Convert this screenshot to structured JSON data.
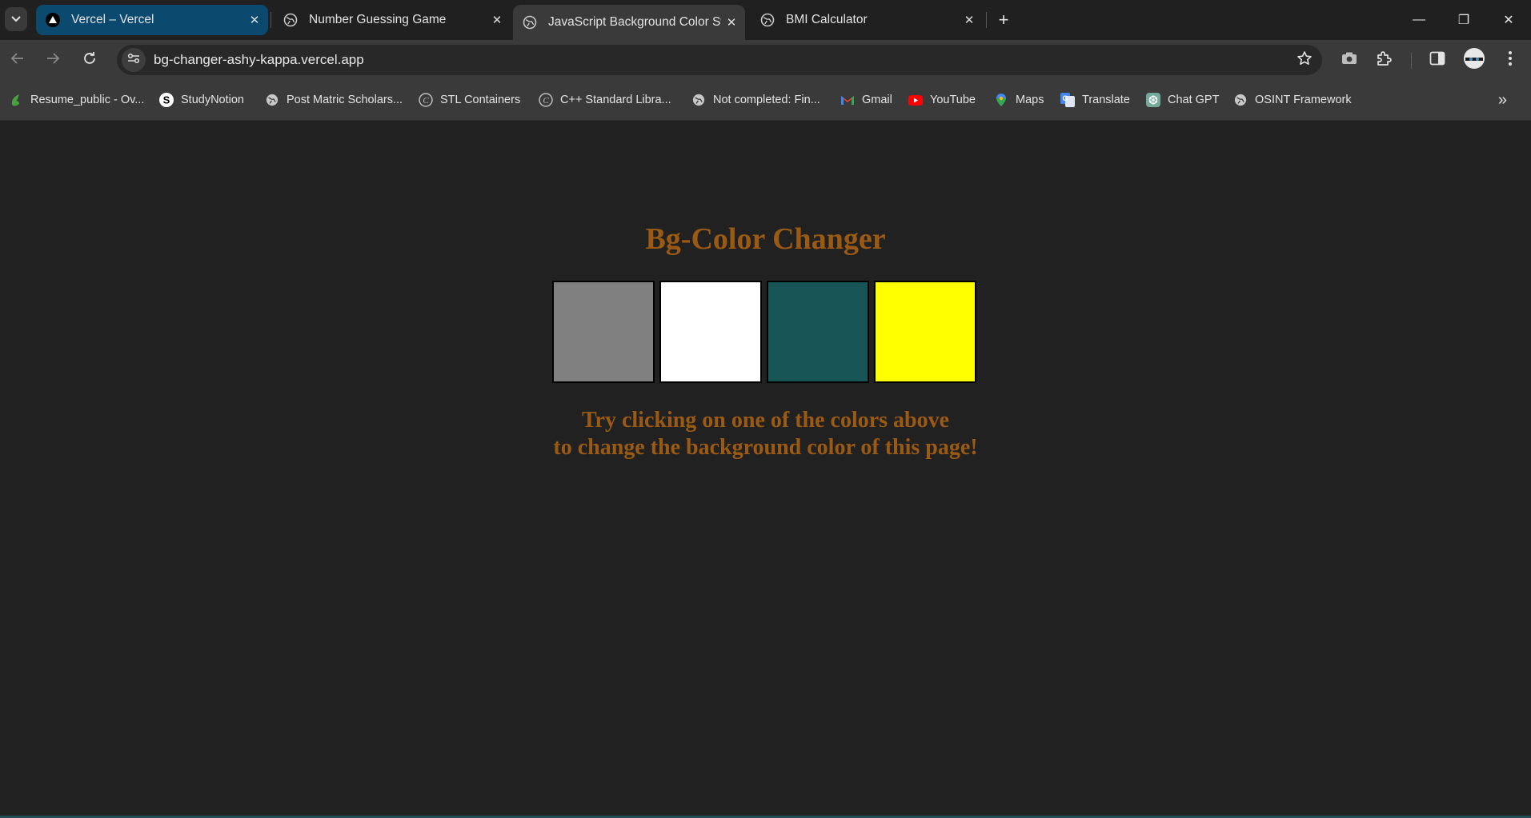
{
  "tabs": [
    {
      "title": "Vercel – Vercel",
      "favicon": "vercel-triangle-icon",
      "active": false
    },
    {
      "title": "Number Guessing Game",
      "favicon": "globe-icon",
      "active": false
    },
    {
      "title": "JavaScript Background Color Sw",
      "favicon": "globe-icon",
      "active": true
    },
    {
      "title": "BMI Calculator",
      "favicon": "globe-icon",
      "active": false
    }
  ],
  "tab_close_glyph": "✕",
  "new_tab_glyph": "+",
  "window": {
    "minimize": "—",
    "restore": "❐",
    "close": "✕"
  },
  "address": {
    "url": "bg-changer-ashy-kappa.vercel.app"
  },
  "bookmarks": [
    {
      "label": "Resume_public - Ov...",
      "icon": "overleaf-icon"
    },
    {
      "label": "StudyNotion",
      "icon": "studynotion-icon"
    },
    {
      "label": "Post Matric Scholars...",
      "icon": "globe-icon"
    },
    {
      "label": "STL Containers",
      "icon": "cplusplus-icon"
    },
    {
      "label": "C++ Standard Libra...",
      "icon": "cplusplus-icon"
    },
    {
      "label": "Not completed: Fin...",
      "icon": "globe-icon"
    },
    {
      "label": "Gmail",
      "icon": "gmail-icon"
    },
    {
      "label": "YouTube",
      "icon": "youtube-icon"
    },
    {
      "label": "Maps",
      "icon": "maps-icon"
    },
    {
      "label": "Translate",
      "icon": "translate-icon"
    },
    {
      "label": "Chat GPT",
      "icon": "chatgpt-icon"
    },
    {
      "label": "OSINT Framework",
      "icon": "globe-icon"
    }
  ],
  "bookmarks_more": "»",
  "page": {
    "heading": "Bg-Color Changer",
    "swatches": [
      {
        "name": "grey",
        "color": "#808080"
      },
      {
        "name": "white",
        "color": "#ffffff"
      },
      {
        "name": "teal",
        "color": "#175557"
      },
      {
        "name": "yellow",
        "color": "#ffff00"
      }
    ],
    "message_line1": "Try clicking on one of the colors above",
    "message_line2": "to change the background color of this page!",
    "text_color": "#9b5a14",
    "background": "#212121"
  }
}
